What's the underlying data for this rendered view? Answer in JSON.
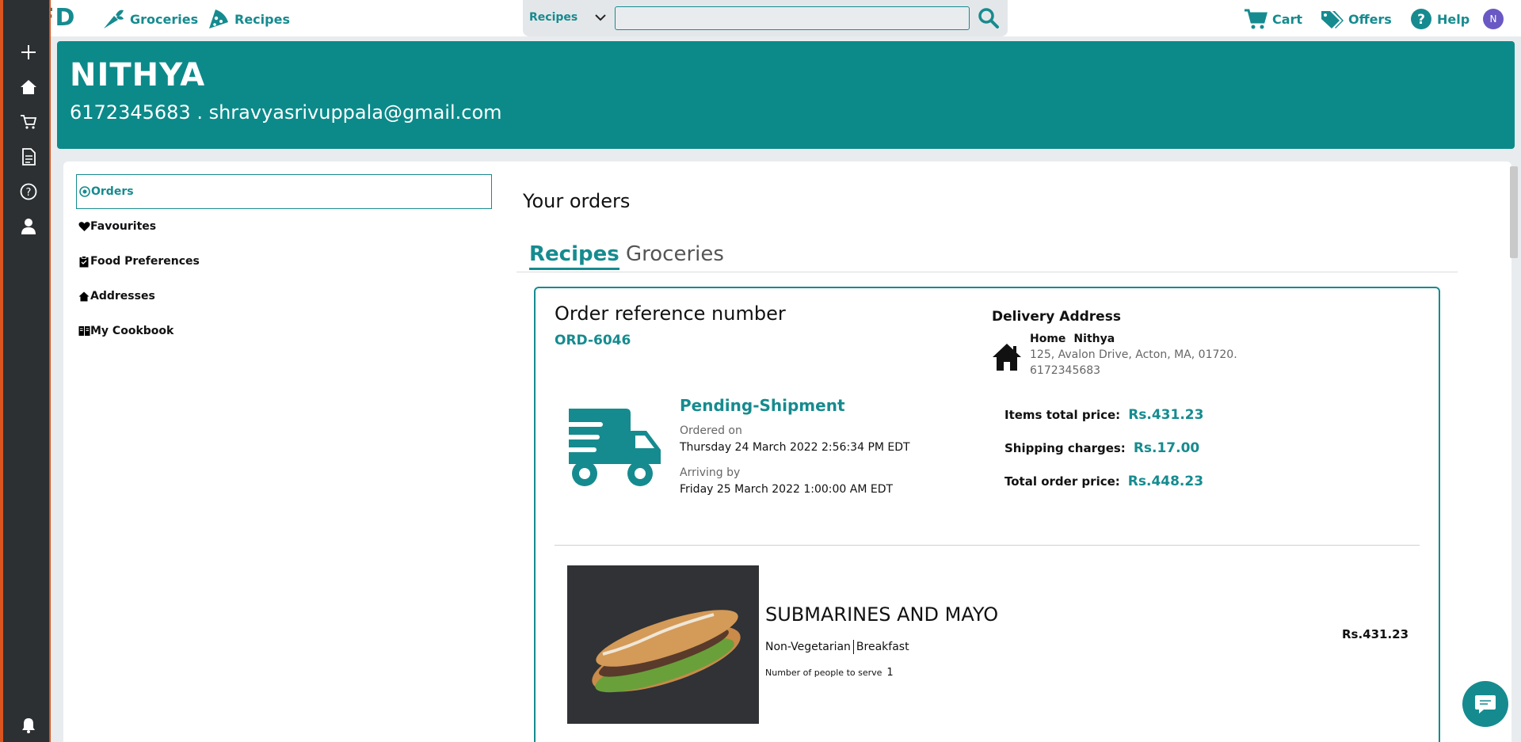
{
  "brand": {
    "logo_text": "FD"
  },
  "nav": {
    "groceries": "Groceries",
    "recipes": "Recipes",
    "cart": "Cart",
    "offers": "Offers",
    "help": "Help",
    "avatar_initial": "N"
  },
  "search": {
    "category": "Recipes",
    "value": ""
  },
  "sidebar": {
    "icons": [
      "plus-icon",
      "home-icon",
      "cart-icon",
      "document-icon",
      "help-icon",
      "user-icon",
      "bell-icon"
    ]
  },
  "profile": {
    "name": "NITHYA",
    "contact": "6172345683 . shravyasrivuppala@gmail.com"
  },
  "menu": {
    "items": [
      "Orders",
      "Favourites",
      "Food Preferences",
      "Addresses",
      "My Cookbook"
    ]
  },
  "orders": {
    "title": "Your orders",
    "tabs": [
      "Recipes",
      "Groceries"
    ],
    "order": {
      "ref_label": "Order reference number",
      "ref_value": "ORD-6046",
      "status": "Pending-Shipment",
      "ordered_label": "Ordered on",
      "ordered_value": "Thursday 24 March 2022 2:56:34 PM EDT",
      "arriving_label": "Arriving by",
      "arriving_value": "Friday 25 March 2022 1:00:00 AM EDT",
      "delivery_title": "Delivery Address",
      "address_type": "Home",
      "address_name": "Nithya",
      "address_line": "125, Avalon Drive, Acton, MA, 01720.",
      "address_phone": "6172345683",
      "items_total_label": "Items total price:",
      "items_total_value": "Rs.431.23",
      "shipping_label": "Shipping charges:",
      "shipping_value": "Rs.17.00",
      "total_label": "Total order price:",
      "total_value": "Rs.448.23",
      "item": {
        "name": "SUBMARINES AND MAYO",
        "tag1": "Non-Vegetarian",
        "tag2": "Breakfast",
        "serve_label": "Number of people to serve",
        "serve_value": "1",
        "price": "Rs.431.23"
      }
    }
  },
  "colors": {
    "accent": "#168b8f",
    "banner": "#0c8a8a",
    "sidebar": "#2c3033",
    "sidebar_edge": "#d9541e"
  }
}
